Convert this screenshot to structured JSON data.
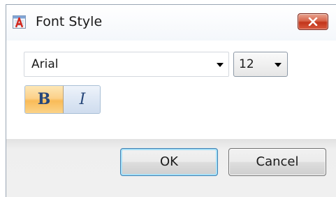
{
  "window": {
    "title": "Font Style",
    "icon": "font-style-app-icon",
    "close_icon": "close-icon"
  },
  "font_family": {
    "value": "Arial",
    "options": [
      "Arial"
    ]
  },
  "font_size": {
    "value": "12"
  },
  "style_toggles": {
    "bold_label": "B",
    "bold_pressed": true,
    "italic_label": "I",
    "italic_pressed": false
  },
  "buttons": {
    "ok_label": "OK",
    "cancel_label": "Cancel"
  },
  "colors": {
    "close_button": "#c2351b",
    "bold_active": "#f9bb58",
    "toggle_text": "#27477a",
    "focus_ring": "#3c7fb1"
  }
}
